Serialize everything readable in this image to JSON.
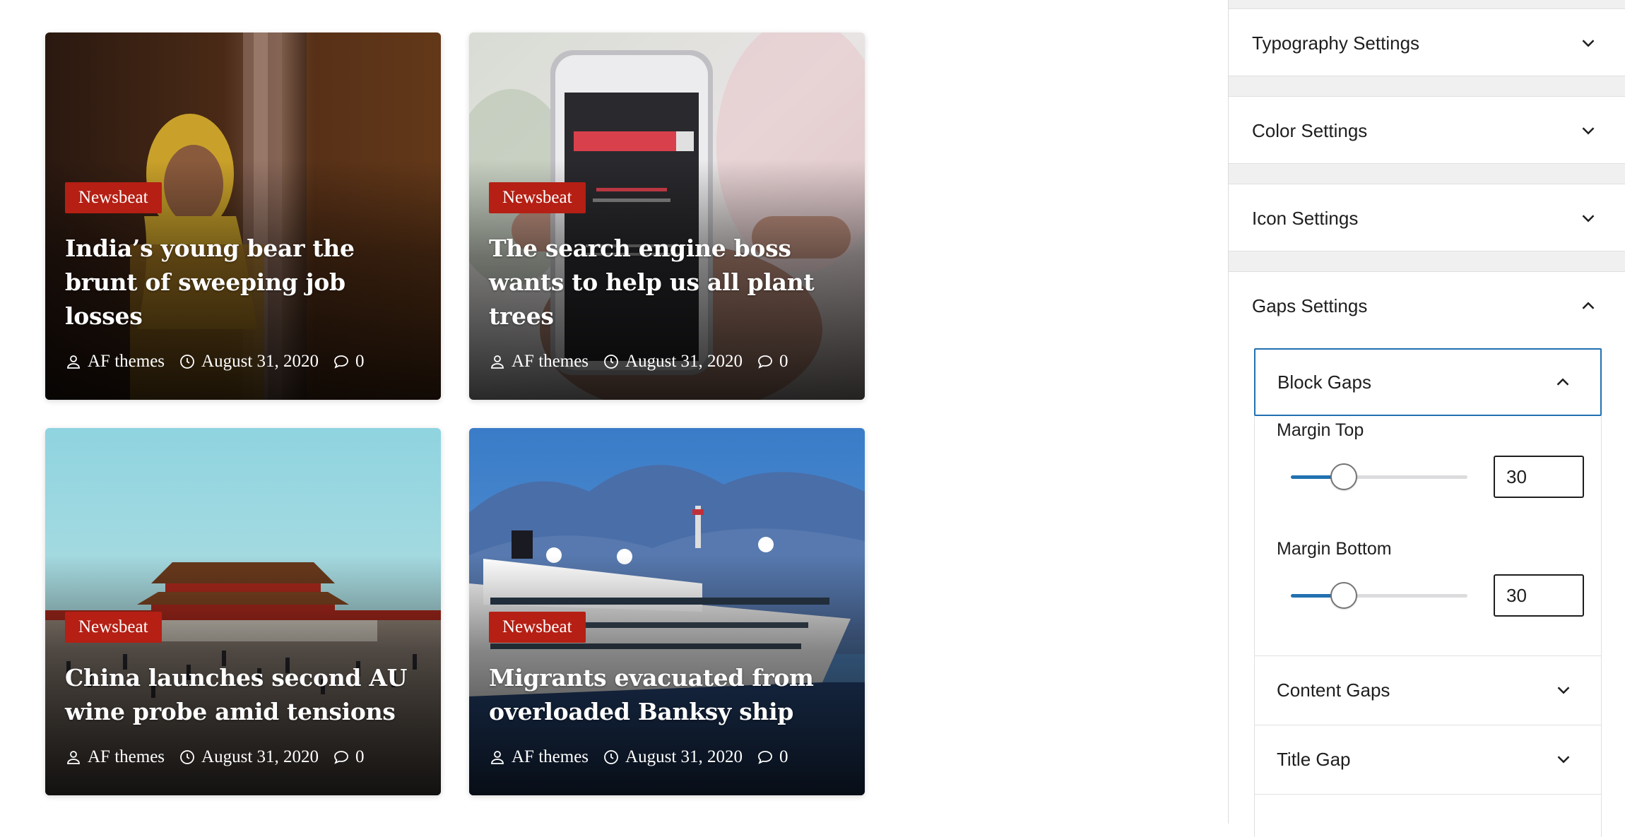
{
  "posts": [
    {
      "category": "Newsbeat",
      "title": "India’s young bear the brunt of sweeping job losses",
      "author": "AF themes",
      "date": "August 31, 2020",
      "comments": "0"
    },
    {
      "category": "Newsbeat",
      "title": "The search engine boss wants to help us all plant trees",
      "author": "AF themes",
      "date": "August 31, 2020",
      "comments": "0"
    },
    {
      "category": "Newsbeat",
      "title": "China launches second AU wine probe amid tensions",
      "author": "AF themes",
      "date": "August 31, 2020",
      "comments": "0"
    },
    {
      "category": "Newsbeat",
      "title": "Migrants evacuated from overloaded Banksy ship",
      "author": "AF themes",
      "date": "August 31, 2020",
      "comments": "0"
    }
  ],
  "sidebar": {
    "panels": {
      "typography": "Typography Settings",
      "color": "Color Settings",
      "icon": "Icon Settings",
      "gaps": "Gaps Settings"
    },
    "gaps": {
      "block_gaps": {
        "title": "Block Gaps",
        "margin_top_label": "Margin Top",
        "margin_top_value": "30",
        "margin_top_fraction": 0.3,
        "margin_bottom_label": "Margin Bottom",
        "margin_bottom_value": "30",
        "margin_bottom_fraction": 0.3
      },
      "content_gaps": "Content Gaps",
      "title_gap": "Title Gap"
    }
  },
  "colors": {
    "category_badge": "#b51f14",
    "accent": "#2271b1"
  }
}
